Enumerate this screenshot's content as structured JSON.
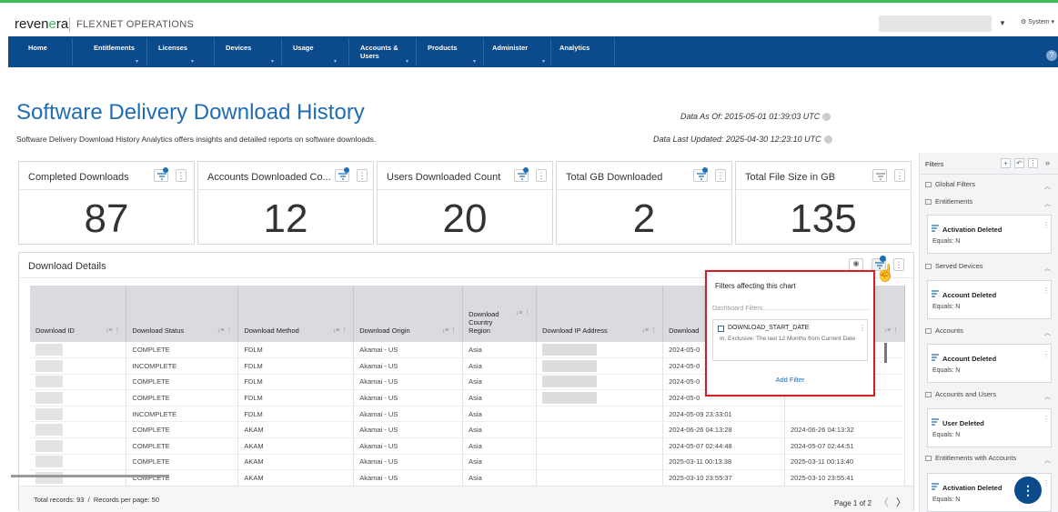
{
  "header": {
    "logo_main": "reven",
    "logo_accent": "e",
    "logo_end": "ra",
    "product": "FLEXNET OPERATIONS",
    "system_label": "System"
  },
  "nav": {
    "items": [
      {
        "label": "Home",
        "dropdown": false
      },
      {
        "label": "Entitlements",
        "dropdown": true
      },
      {
        "label": "Licenses",
        "dropdown": true
      },
      {
        "label": "Devices",
        "dropdown": true
      },
      {
        "label": "Usage",
        "dropdown": true
      },
      {
        "label": "Accounts & Users",
        "dropdown": true
      },
      {
        "label": "Products",
        "dropdown": true
      },
      {
        "label": "Administer",
        "dropdown": true
      },
      {
        "label": "Analytics",
        "dropdown": false
      }
    ]
  },
  "page": {
    "title": "Software Delivery Download History",
    "description": "Software Delivery Download History Analytics offers insights and detailed reports on software downloads.",
    "data_as_of": "Data As Of: 2015-05-01 01:39:03 UTC",
    "data_last_updated": "Data Last Updated: 2025-04-30 12:23:10 UTC"
  },
  "cards": [
    {
      "title": "Completed Downloads",
      "value": "87",
      "filter_active": true
    },
    {
      "title": "Accounts Downloaded Co...",
      "value": "12",
      "filter_active": true
    },
    {
      "title": "Users Downloaded Count",
      "value": "20",
      "filter_active": true
    },
    {
      "title": "Total GB Downloaded",
      "value": "2",
      "filter_active": true
    },
    {
      "title": "Total File Size in GB",
      "value": "135",
      "filter_active": false
    }
  ],
  "details": {
    "title": "Download Details",
    "columns": [
      "Download ID",
      "Download Status",
      "Download Method",
      "Download Origin",
      "Download Country Region",
      "Download IP Address",
      "Download",
      ""
    ],
    "rows": [
      {
        "status": "COMPLETE",
        "method": "FDLM",
        "origin": "Akamai - US",
        "region": "Asia",
        "date1": "2024-05-0",
        "date2": ""
      },
      {
        "status": "INCOMPLETE",
        "method": "FDLM",
        "origin": "Akamai - US",
        "region": "Asia",
        "date1": "2024-05-0",
        "date2": ""
      },
      {
        "status": "COMPLETE",
        "method": "FDLM",
        "origin": "Akamai - US",
        "region": "Asia",
        "date1": "2024-05-0",
        "date2": ""
      },
      {
        "status": "COMPLETE",
        "method": "FDLM",
        "origin": "Akamai - US",
        "region": "Asia",
        "date1": "2024-05-0",
        "date2": ""
      },
      {
        "status": "INCOMPLETE",
        "method": "FDLM",
        "origin": "Akamai - US",
        "region": "Asia",
        "date1": "2024-05-09 23:33:01",
        "date2": ""
      },
      {
        "status": "COMPLETE",
        "method": "AKAM",
        "origin": "Akamai - US",
        "region": "Asia",
        "date1": "2024-06-26 04:13:28",
        "date2": "2024-06-26 04:13:32"
      },
      {
        "status": "COMPLETE",
        "method": "AKAM",
        "origin": "Akamai - US",
        "region": "Asia",
        "date1": "2024-05-07 02:44:48",
        "date2": "2024-05-07 02:44:51"
      },
      {
        "status": "COMPLETE",
        "method": "AKAM",
        "origin": "Akamai - US",
        "region": "Asia",
        "date1": "2025-03-11 00:13:38",
        "date2": "2025-03-11 00:13:40"
      },
      {
        "status": "COMPLETE",
        "method": "AKAM",
        "origin": "Akamai - US",
        "region": "Asia",
        "date1": "2025-03-10 23:55:37",
        "date2": "2025-03-10 23:55:41"
      }
    ],
    "total_records": "Total records: 93",
    "per_page": "Records per page: 50",
    "page_info": "Page 1 of 2"
  },
  "popup": {
    "title": "Filters affecting this chart",
    "section": "Dashboard Filters",
    "filter_name": "DOWNLOAD_START_DATE",
    "filter_desc": "In, Exclusive: The last 12 Months from Current Date",
    "add_label": "Add Filter"
  },
  "filters_panel": {
    "title": "Filters",
    "global_label": "Global Filters",
    "sections": [
      {
        "label": "Entitlements",
        "filter": "Activation Deleted",
        "value": "Equals: N"
      },
      {
        "label": "Served Devices",
        "filter": "Account Deleted",
        "value": "Equals: N"
      },
      {
        "label": "Accounts",
        "filter": "Account Deleted",
        "value": "Equals: N"
      },
      {
        "label": "Accounts and Users",
        "filter": "User Deleted",
        "value": "Equals: N"
      },
      {
        "label": "Entitlements with Accounts",
        "filter": "Activation Deleted",
        "value": "Equals: N"
      }
    ]
  },
  "colors": {
    "accent": "#1e6cb3",
    "navbar": "#0b4a8b",
    "brand_green": "#3dbd56",
    "highlight_border": "#d11f26"
  }
}
